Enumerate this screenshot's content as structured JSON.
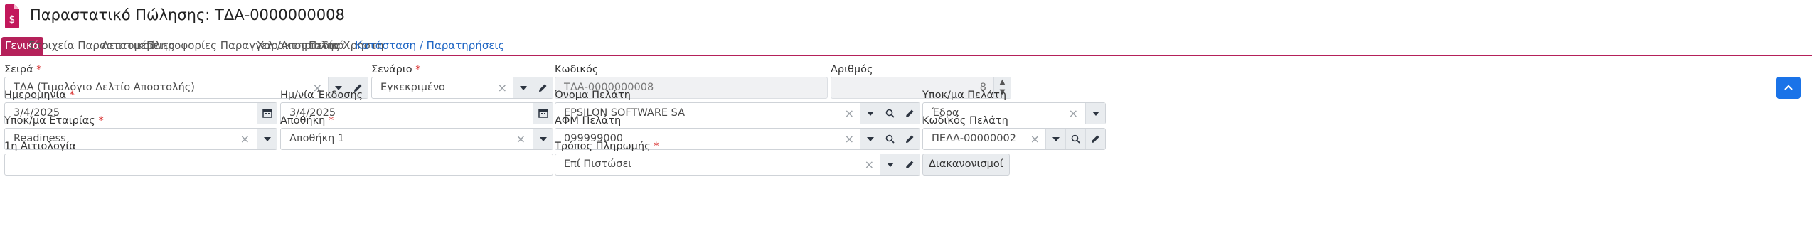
{
  "title": "Παραστατικό Πώλησης: ΤΔΑ-0000000008",
  "tabs": [
    {
      "label": "Γενικά"
    },
    {
      "label": "Στοιχεία Παραστατικού"
    },
    {
      "label": "Λεπτομέρειες"
    },
    {
      "label": "Πληροφορίες Παραγγελ./Αποστολής"
    },
    {
      "label": "Χαρακτηριστικά"
    },
    {
      "label": "Πεδία Χρήστη"
    },
    {
      "label": "Κατάσταση / Παρατηρήσεις"
    }
  ],
  "fields": {
    "seira": {
      "label": "Σειρά",
      "required": "*",
      "value": "ΤΔΑ (Τιμολόγιο Δελτίο Αποστολής)"
    },
    "senario": {
      "label": "Σενάριο",
      "required": "*",
      "value": "Εγκεκριμένο"
    },
    "kodikos": {
      "label": "Κωδικός",
      "value": "ΤΔΑ-0000000008"
    },
    "arithmos": {
      "label": "Αριθμός",
      "value": "8"
    },
    "imerominia": {
      "label": "Ημερομηνία",
      "required": "*",
      "value": "3/4/2025"
    },
    "ekdosi": {
      "label": "Ημ/νία Έκδοσης",
      "value": "3/4/2025"
    },
    "onoma_pelati": {
      "label": "Όνομα Πελάτη",
      "value": "EPSILON SOFTWARE SA"
    },
    "ypok_pelati": {
      "label": "Υποκ/μα Πελάτη",
      "value": "Έδρα"
    },
    "ypok_etairias": {
      "label": "Υποκ/μα Εταιρίας",
      "required": "*",
      "value": "Readiness"
    },
    "apothiki": {
      "label": "Αποθήκη",
      "required": "*",
      "value": "Αποθήκη 1"
    },
    "afm": {
      "label": "ΑΦΜ Πελάτη",
      "value": "099999000"
    },
    "kodikos_pelati": {
      "label": "Κωδικός Πελάτη",
      "value": "ΠΕΛΑ-00000002"
    },
    "aitiologia": {
      "label": "1η Αιτιολογία",
      "value": ""
    },
    "tropos": {
      "label": "Τρόπος Πληρωμής",
      "required": "*",
      "value": "Επί Πιστώσει"
    }
  },
  "buttons": {
    "diakanonismoi": "Διακανονισμοί"
  },
  "symbols": {
    "clear": "×",
    "spin_up": "▲",
    "spin_down": "▼"
  },
  "icons": [
    "document-money-icon",
    "caret-down-icon",
    "pencil-icon",
    "search-icon",
    "calendar-icon",
    "chevron-up-icon"
  ],
  "colors": {
    "accent": "#b5215a",
    "link": "#1f66c4",
    "primary": "#1a73e8"
  }
}
